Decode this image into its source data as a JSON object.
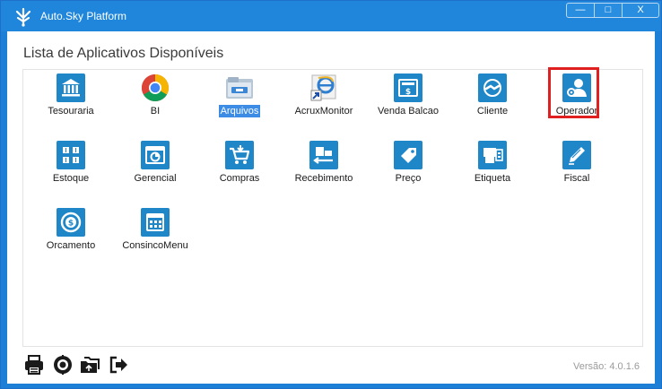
{
  "window": {
    "title": "Auto.Sky Platform",
    "controls": {
      "minimize": "—",
      "maximize": "□",
      "close": "X"
    }
  },
  "main": {
    "heading": "Lista de Aplicativos Disponíveis",
    "apps": [
      {
        "label": "Tesouraria",
        "icon": "bank-icon",
        "selected": false
      },
      {
        "label": "BI",
        "icon": "chrome-icon",
        "selected": false
      },
      {
        "label": "Arquivos",
        "icon": "file-explorer-icon",
        "selected": true
      },
      {
        "label": "AcruxMonitor",
        "icon": "ie-shortcut-icon",
        "selected": false
      },
      {
        "label": "Venda Balcao",
        "icon": "cash-register-icon",
        "selected": false
      },
      {
        "label": "Cliente",
        "icon": "customer-handshake-icon",
        "selected": false
      },
      {
        "label": "Operador",
        "icon": "operator-gear-icon",
        "selected": false,
        "highlighted": true
      },
      {
        "label": "Estoque",
        "icon": "warehouse-icon",
        "selected": false
      },
      {
        "label": "Gerencial",
        "icon": "dashboard-icon",
        "selected": false
      },
      {
        "label": "Compras",
        "icon": "shopping-cart-icon",
        "selected": false
      },
      {
        "label": "Recebimento",
        "icon": "receiving-icon",
        "selected": false
      },
      {
        "label": "Preço",
        "icon": "price-tag-icon",
        "selected": false
      },
      {
        "label": "Etiqueta",
        "icon": "label-printer-icon",
        "selected": false
      },
      {
        "label": "Fiscal",
        "icon": "pencil-icon",
        "selected": false
      },
      {
        "label": "Orcamento",
        "icon": "money-cycle-icon",
        "selected": false
      },
      {
        "label": "ConsincoMenu",
        "icon": "grid-menu-icon",
        "selected": false
      }
    ]
  },
  "footer": {
    "version": "Versão: 4.0.1.6",
    "icons": [
      "printer-icon",
      "gear-icon",
      "folders-icon",
      "exit-icon"
    ]
  },
  "colors": {
    "titlebar": "#1f86dc",
    "tile": "#1f86c8",
    "selection": "#3c8ce6",
    "highlight": "#e02020"
  }
}
